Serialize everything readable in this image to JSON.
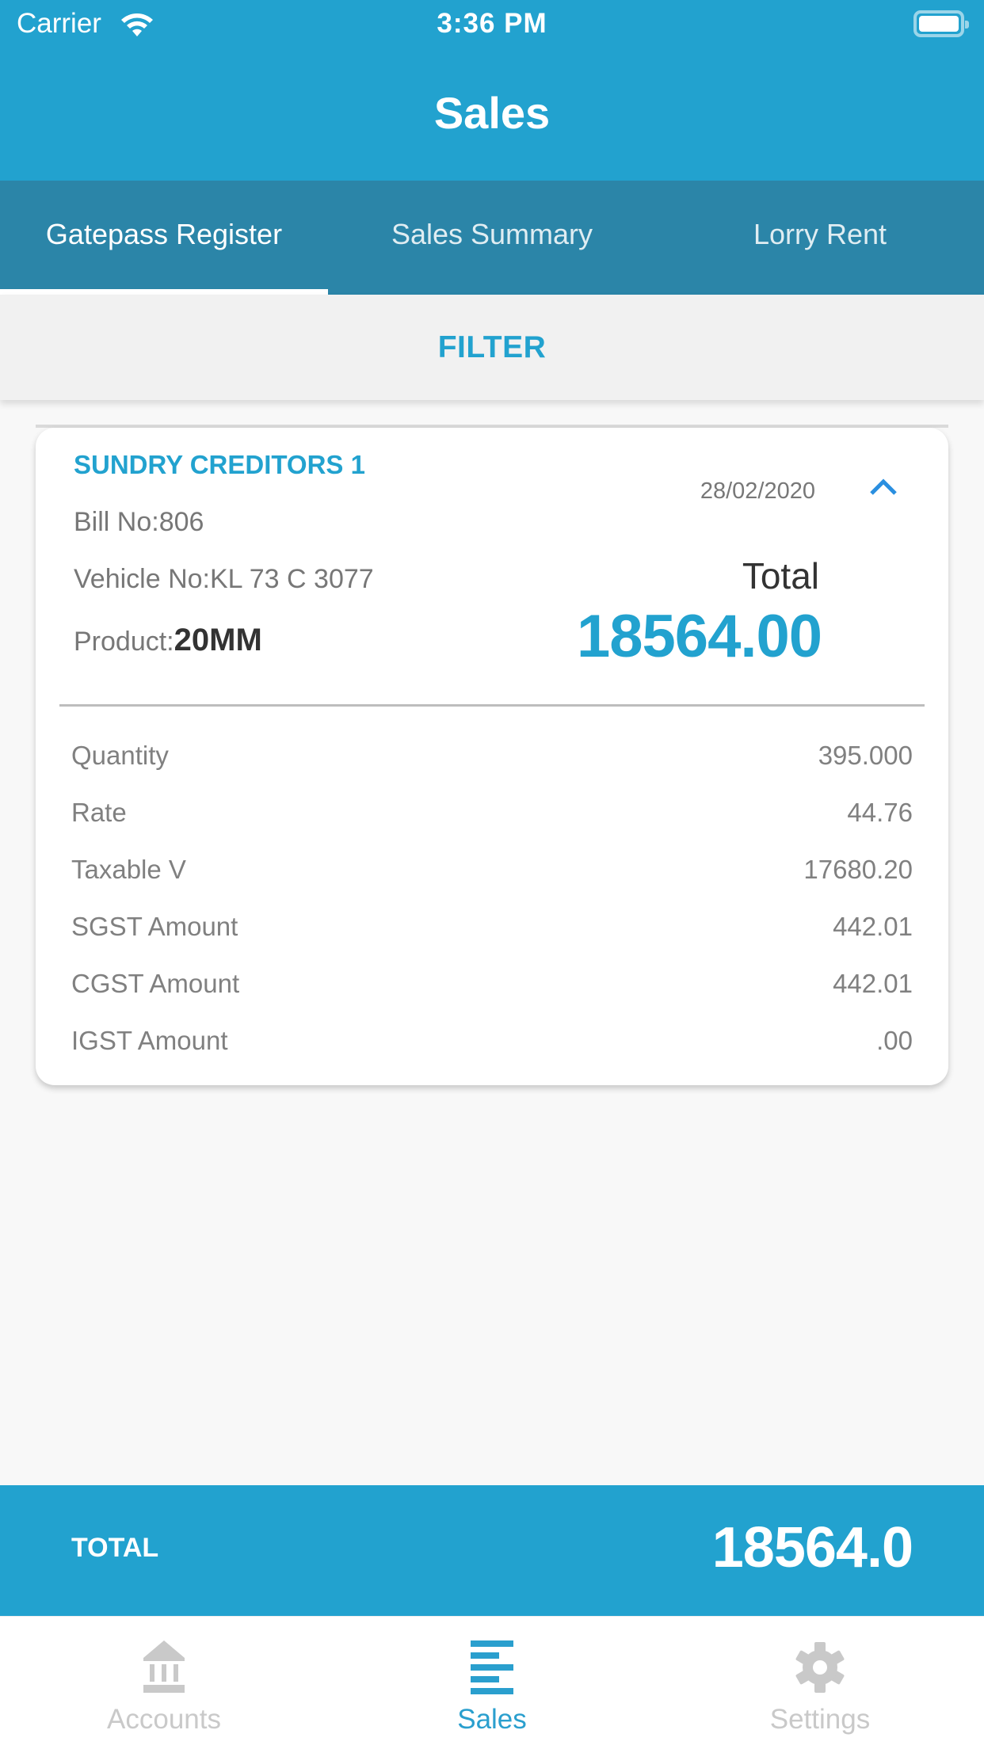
{
  "status_bar": {
    "carrier": "Carrier",
    "time": "3:36 PM"
  },
  "nav": {
    "title": "Sales"
  },
  "tabs": [
    {
      "label": "Gatepass Register",
      "active": true
    },
    {
      "label": "Sales Summary",
      "active": false
    },
    {
      "label": "Lorry Rent",
      "active": false
    }
  ],
  "filter": {
    "label": "FILTER"
  },
  "card": {
    "party": "SUNDRY CREDITORS 1",
    "date": "28/02/2020",
    "bill_no": "Bill No:806",
    "vehicle_no": "Vehicle No:KL 73 C 3077",
    "product_label": "Product:",
    "product_value": "20MM",
    "total_label": "Total",
    "total_value": "18564.00",
    "details": [
      {
        "label": "Quantity",
        "value": "395.000"
      },
      {
        "label": "Rate",
        "value": "44.76"
      },
      {
        "label": "Taxable V",
        "value": "17680.20"
      },
      {
        "label": "SGST Amount",
        "value": "442.01"
      },
      {
        "label": "CGST Amount",
        "value": "442.01"
      },
      {
        "label": "IGST Amount",
        "value": ".00"
      }
    ]
  },
  "total_bar": {
    "label": "TOTAL",
    "value": "18564.0"
  },
  "tab_bar": [
    {
      "label": "Accounts",
      "icon": "bank-icon",
      "active": false
    },
    {
      "label": "Sales",
      "icon": "list-icon",
      "active": true
    },
    {
      "label": "Settings",
      "icon": "gear-icon",
      "active": false
    }
  ],
  "colors": {
    "primary": "#22A2CF",
    "tab_bar_bg": "#2B85A8",
    "inactive": "#C9C9C9"
  }
}
